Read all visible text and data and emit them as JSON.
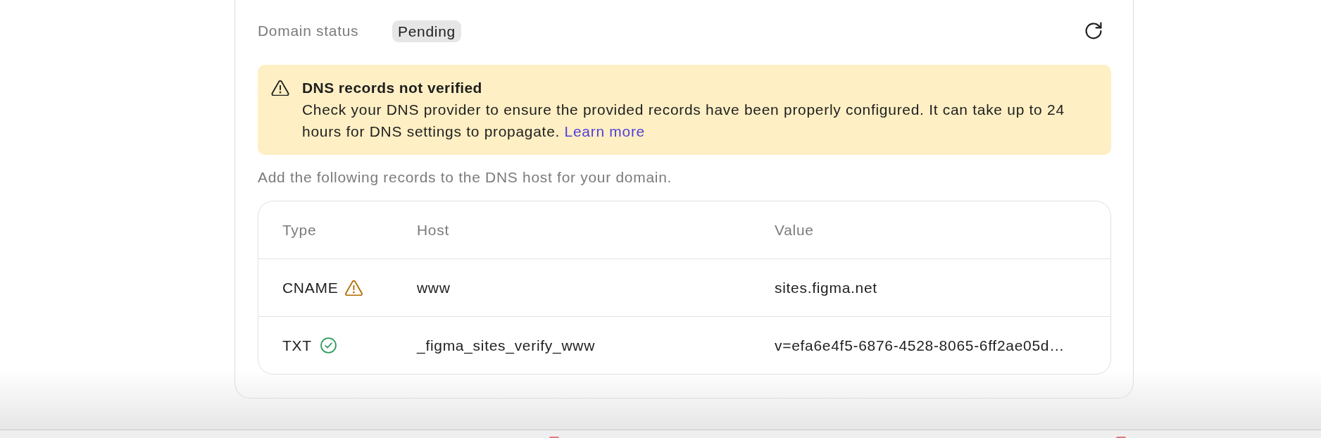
{
  "domain_status": {
    "label": "Domain status",
    "badge": "Pending"
  },
  "alert": {
    "kind": "warning",
    "title": "DNS records not verified",
    "body": "Check your DNS provider to ensure the provided records have been properly configured. It can take up to 24 hours for DNS settings to propagate.",
    "link": "Learn more"
  },
  "instructions": "Add the following records to the DNS host for your domain.",
  "records": {
    "columns": [
      "Type",
      "Host",
      "Value"
    ],
    "rows": [
      {
        "type": "CNAME",
        "verified": false,
        "host": "www",
        "value": "sites.figma.net"
      },
      {
        "type": "TXT",
        "verified": true,
        "host": "_figma_sites_verify_www",
        "value": "v=efa6e4f5-6876-4528-8065-6ff2ae05d…"
      }
    ]
  }
}
